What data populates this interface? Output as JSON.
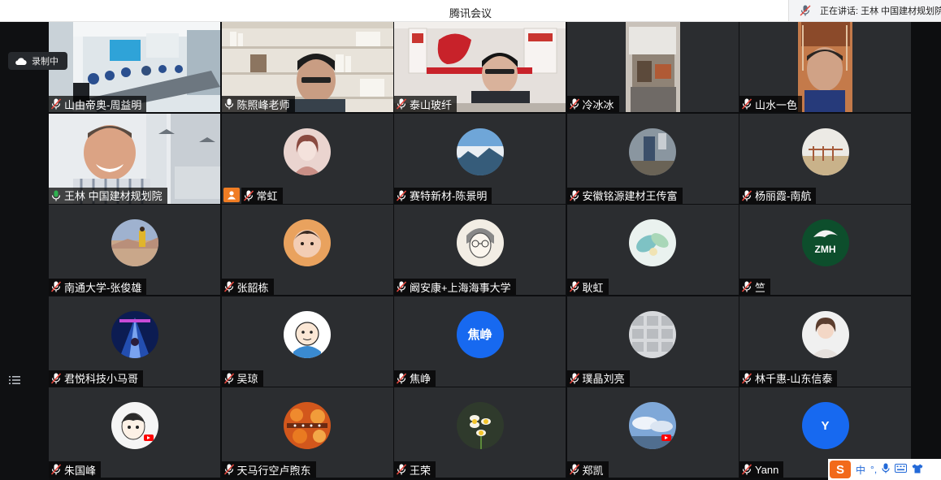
{
  "window": {
    "title": "腾讯会议"
  },
  "speaking": {
    "text": "正在讲话: 王林 中国建材规划院"
  },
  "recording": {
    "label": "录制中"
  },
  "participants": [
    {
      "name": "山由帝奥-周益明",
      "kind": "video",
      "scene": "meeting-room",
      "mic": "muted"
    },
    {
      "name": "陈照峰老师",
      "kind": "video",
      "scene": "bookshelf",
      "mic": "on"
    },
    {
      "name": "泰山玻纤",
      "kind": "video",
      "scene": "party-wall",
      "mic": "muted"
    },
    {
      "name": "冷冰冰",
      "kind": "video",
      "scene": "phone-photo",
      "mic": "muted"
    },
    {
      "name": "山水一色",
      "kind": "video",
      "scene": "older-man",
      "mic": "muted"
    },
    {
      "name": "王林 中国建材规划院",
      "kind": "video",
      "scene": "speaker",
      "mic": "speaking",
      "active": true
    },
    {
      "name": "常虹",
      "kind": "avatar",
      "avatar": "portrait-sketch",
      "mic": "muted",
      "host": true
    },
    {
      "name": "赛特新材-陈景明",
      "kind": "avatar",
      "avatar": "mountain-cloud",
      "mic": "muted"
    },
    {
      "name": "安徽铭源建材王传富",
      "kind": "avatar",
      "avatar": "street-photo",
      "mic": "muted"
    },
    {
      "name": "杨丽霞-南航",
      "kind": "avatar",
      "avatar": "beach-rail",
      "mic": "muted"
    },
    {
      "name": "南通大学-张俊雄",
      "kind": "avatar",
      "avatar": "desert-person",
      "mic": "muted"
    },
    {
      "name": "张韶栋",
      "kind": "avatar",
      "avatar": "baby",
      "mic": "muted"
    },
    {
      "name": "阚安康+上海海事大学",
      "kind": "avatar",
      "avatar": "cartoon-glasses",
      "mic": "muted"
    },
    {
      "name": "耿虹",
      "kind": "avatar",
      "avatar": "watercolor-leaf",
      "mic": "muted"
    },
    {
      "name": "竺",
      "kind": "avatar",
      "avatar": "zmh-logo",
      "logo_text": "ZMH",
      "mic": "muted"
    },
    {
      "name": "君悦科技小马哥",
      "kind": "avatar",
      "avatar": "stage-lights",
      "mic": "muted"
    },
    {
      "name": "吴琼",
      "kind": "avatar",
      "avatar": "cartoon-man",
      "mic": "muted"
    },
    {
      "name": "焦峥",
      "kind": "avatar",
      "avatar": "initials",
      "initials": "焦峥",
      "color": "#1769f0",
      "mic": "muted"
    },
    {
      "name": "璞晶刘亮",
      "kind": "avatar",
      "avatar": "photo-grid",
      "mic": "muted"
    },
    {
      "name": "林千惠-山东信泰",
      "kind": "avatar",
      "avatar": "woman-portrait",
      "mic": "muted"
    },
    {
      "name": "朱国峰",
      "kind": "avatar",
      "avatar": "anime-boy",
      "mic": "muted"
    },
    {
      "name": "天马行空卢煦东",
      "kind": "avatar",
      "avatar": "orange-food",
      "mic": "muted"
    },
    {
      "name": "王荣",
      "kind": "avatar",
      "avatar": "daffodil",
      "mic": "muted"
    },
    {
      "name": "郑凯",
      "kind": "avatar",
      "avatar": "blue-sky",
      "mic": "muted"
    },
    {
      "name": "Yann",
      "kind": "avatar",
      "avatar": "initials",
      "initials": "Y",
      "color": "#1769f0",
      "mic": "muted"
    }
  ],
  "ime": {
    "logo": "S",
    "mode": "中",
    "punct": "°,"
  },
  "colors": {
    "active_border": "#2fb050",
    "muted_mic": "#e2453c",
    "host_badge": "#f07d24",
    "initials_bg": "#1769f0"
  }
}
